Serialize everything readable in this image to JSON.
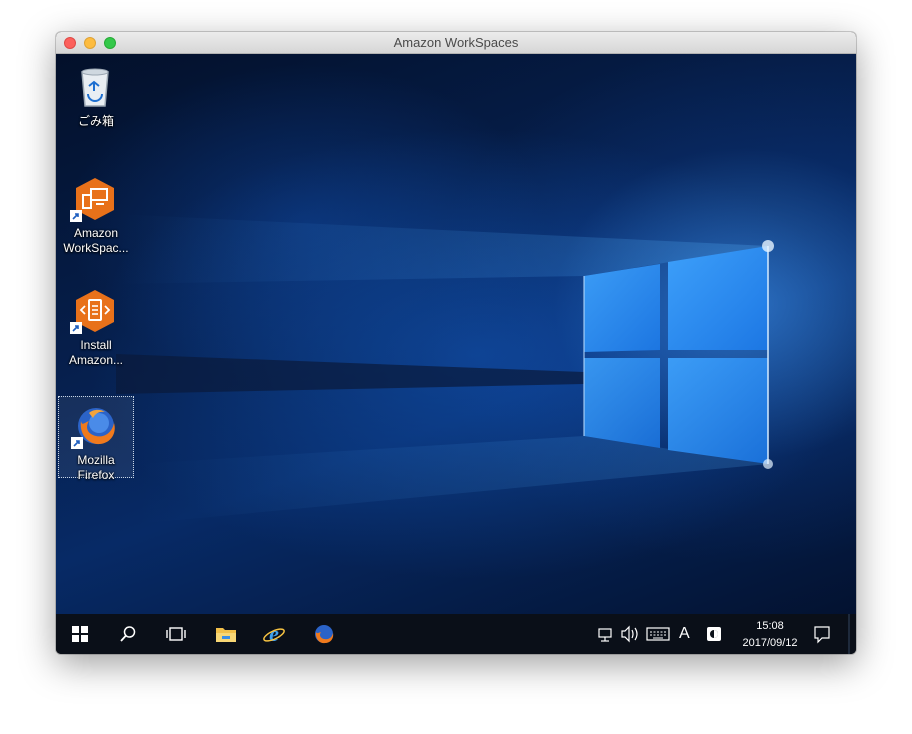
{
  "window": {
    "title": "Amazon WorkSpaces"
  },
  "desktop": {
    "icons": [
      {
        "label_line1": "ごみ箱",
        "label_line2": "",
        "icon": "recycle-bin-icon"
      },
      {
        "label_line1": "Amazon",
        "label_line2": "WorkSpac...",
        "icon": "amazon-workspaces-icon"
      },
      {
        "label_line1": "Install",
        "label_line2": "Amazon...",
        "icon": "install-amazon-icon"
      },
      {
        "label_line1": "Mozilla",
        "label_line2": "Firefox",
        "icon": "firefox-icon"
      }
    ]
  },
  "taskbar": {
    "pinned": [
      "start-icon",
      "search-icon",
      "task-view-icon",
      "file-explorer-icon",
      "internet-explorer-icon",
      "firefox-icon"
    ],
    "ime_mode": "A",
    "time": "15:08",
    "date": "2017/09/12"
  },
  "colors": {
    "workspaces_orange": "#e8711a",
    "taskbar": "#0a0f18",
    "desktop_blue": "#0a4aa8"
  }
}
